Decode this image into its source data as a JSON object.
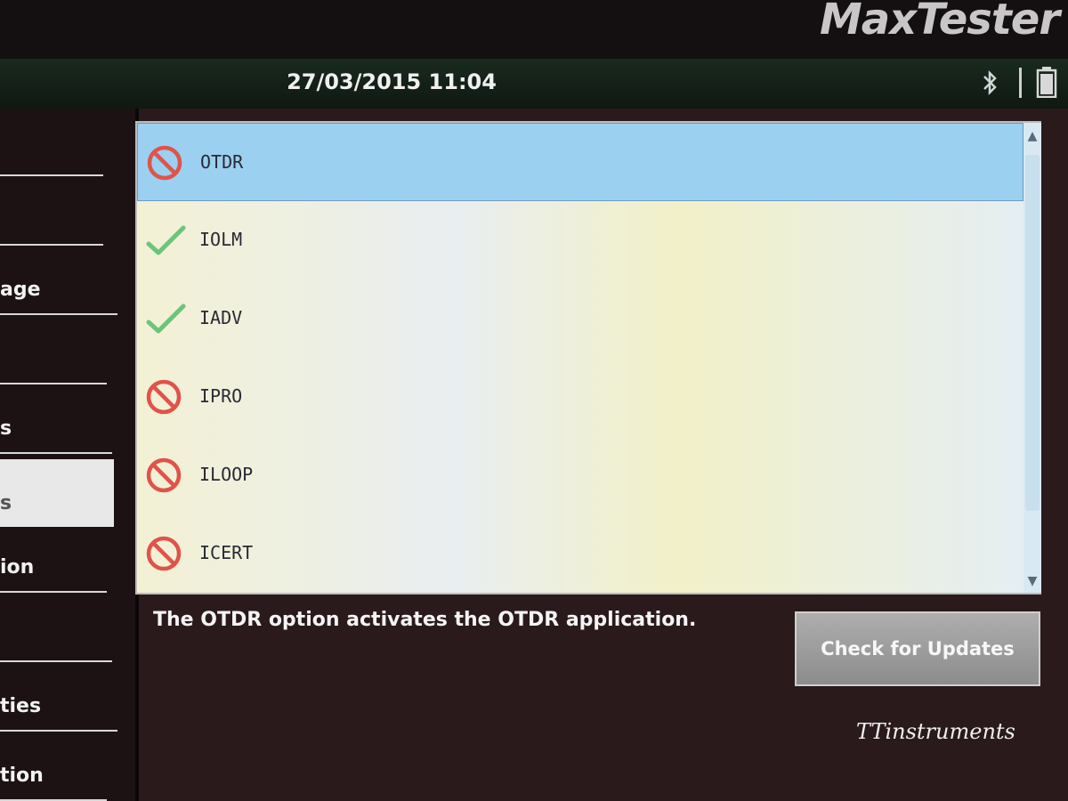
{
  "device": {
    "brand": "MaxTester"
  },
  "status_bar": {
    "datetime": "27/03/2015 11:04",
    "icons": [
      "bluetooth-icon",
      "battery-icon"
    ]
  },
  "sidebar": {
    "items": [
      {
        "label": ""
      },
      {
        "label": ""
      },
      {
        "label": "age"
      },
      {
        "label": ""
      },
      {
        "label": "s"
      },
      {
        "label": "s",
        "selected": true
      },
      {
        "label": "ion"
      },
      {
        "label": ""
      },
      {
        "label": "ties"
      },
      {
        "label": "tion"
      }
    ]
  },
  "options": {
    "items": [
      {
        "label": "OTDR",
        "status": "inactive",
        "icon": "prohibited-icon",
        "selected": true
      },
      {
        "label": "IOLM",
        "status": "active",
        "icon": "checkmark-icon"
      },
      {
        "label": "IADV",
        "status": "active",
        "icon": "checkmark-icon"
      },
      {
        "label": "IPRO",
        "status": "inactive",
        "icon": "prohibited-icon"
      },
      {
        "label": "ILOOP",
        "status": "inactive",
        "icon": "prohibited-icon"
      },
      {
        "label": "ICERT",
        "status": "inactive",
        "icon": "prohibited-icon"
      }
    ]
  },
  "description": "The OTDR option activates the OTDR application.",
  "actions": {
    "check_updates_label": "Check for Updates"
  },
  "watermark": "TTinstruments",
  "colors": {
    "selected_row": "#9bd0f0",
    "prohibited": "#e0534a",
    "check": "#6cc47a"
  }
}
